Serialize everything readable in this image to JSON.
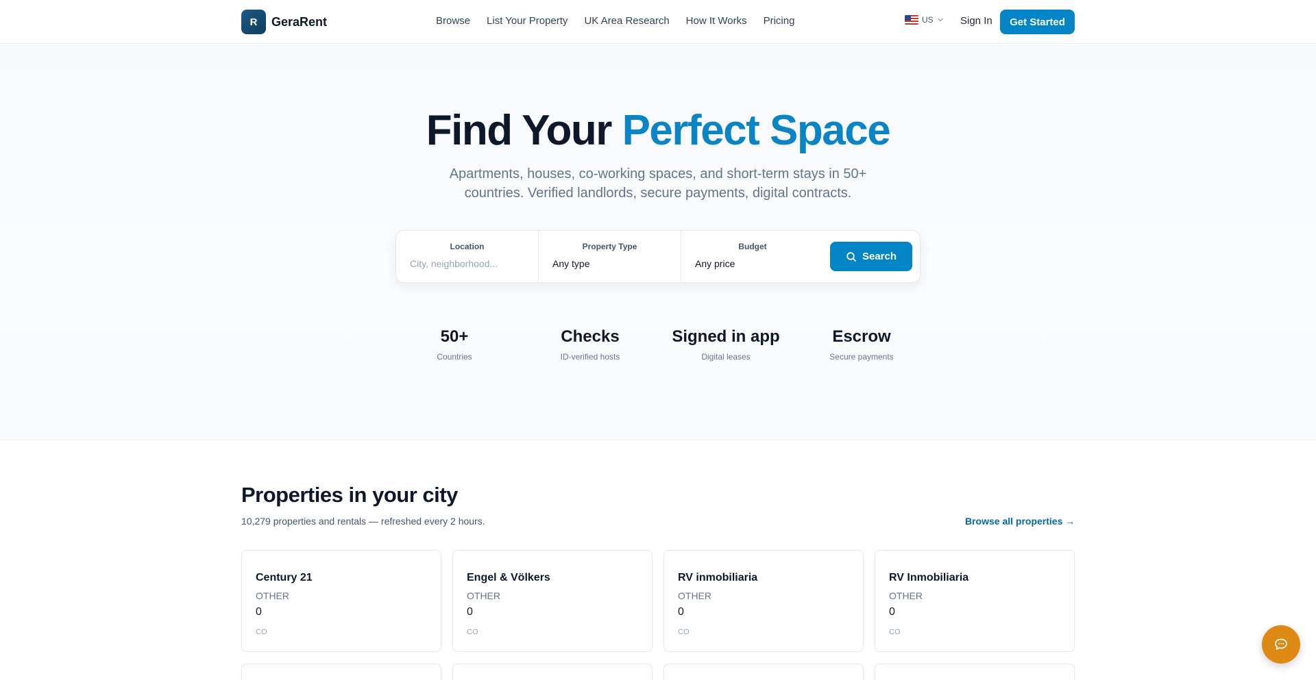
{
  "brand": {
    "logo_letter": "R",
    "name": "GeraRent"
  },
  "nav": {
    "items": [
      {
        "label": "Browse"
      },
      {
        "label": "List Your Property"
      },
      {
        "label": "UK Area Research"
      },
      {
        "label": "How It Works"
      },
      {
        "label": "Pricing"
      }
    ],
    "locale": {
      "flag_icon": "us-flag-icon",
      "label": "US"
    },
    "signin_label": "Sign In",
    "get_started_label": "Get Started"
  },
  "hero": {
    "title_part1": "Find Your ",
    "title_accent": "Perfect Space",
    "subtitle": "Apartments, houses, co-working spaces, and short-term stays in 50+ countries. Verified landlords, secure payments, digital contracts.",
    "search": {
      "location_label": "Location",
      "location_placeholder": "City, neighborhood...",
      "location_value": "",
      "type_label": "Property Type",
      "type_value": "Any type",
      "budget_label": "Budget",
      "budget_value": "Any price",
      "button_label": "Search",
      "button_icon": "search-icon"
    },
    "stats": [
      {
        "value": "50+",
        "label": "Countries"
      },
      {
        "value": "Checks",
        "label": "ID-verified hosts"
      },
      {
        "value": "Signed in app",
        "label": "Digital leases"
      },
      {
        "value": "Escrow",
        "label": "Secure payments"
      }
    ]
  },
  "properties": {
    "title": "Properties in your city",
    "subtitle": "10,279 properties and rentals — refreshed every 2 hours.",
    "browse_all_label": "Browse all properties →",
    "cards": [
      {
        "name": "Century 21",
        "type": "OTHER",
        "price": "0",
        "country": "CO"
      },
      {
        "name": "Engel & Völkers",
        "type": "OTHER",
        "price": "0",
        "country": "CO"
      },
      {
        "name": "RV inmobiliaria",
        "type": "OTHER",
        "price": "0",
        "country": "CO"
      },
      {
        "name": "RV Inmobiliaria",
        "type": "OTHER",
        "price": "0",
        "country": "CO"
      }
    ]
  },
  "chat": {
    "icon": "chat-bubble-icon"
  },
  "colors": {
    "accent": "#0284c7",
    "title_accent": "#0b84c4",
    "chat_button": "#dd8a14",
    "text": "#0f172a",
    "muted": "#64748b"
  }
}
